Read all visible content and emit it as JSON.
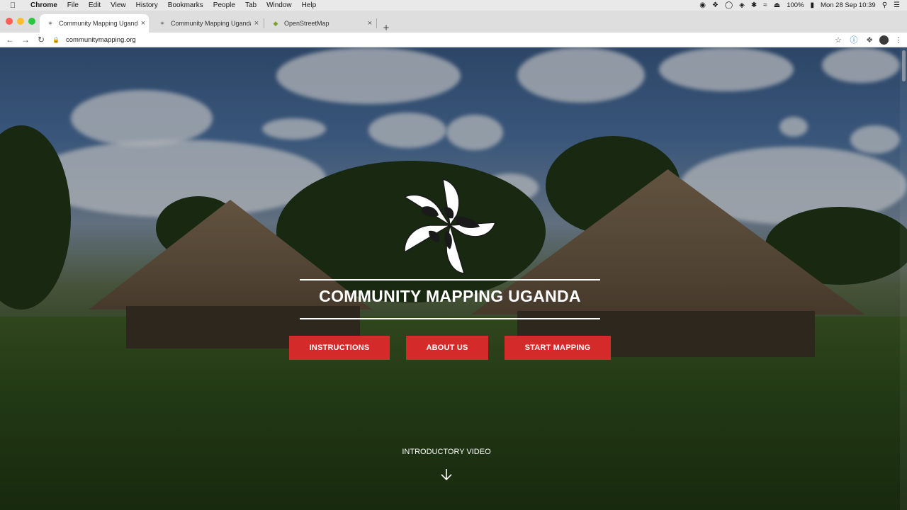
{
  "menubar": {
    "app": "Chrome",
    "items": [
      "File",
      "Edit",
      "View",
      "History",
      "Bookmarks",
      "People",
      "Tab",
      "Window",
      "Help"
    ],
    "battery": "100%",
    "datetime": "Mon 28 Sep  10:39"
  },
  "tabs": [
    {
      "title": "Community Mapping Uganda",
      "icon": "compass-star-favicon",
      "active": true
    },
    {
      "title": "Community Mapping Uganda",
      "icon": "compass-star-favicon",
      "active": false
    },
    {
      "title": "OpenStreetMap",
      "icon": "osm-favicon",
      "active": false
    }
  ],
  "address": {
    "url": "communitymapping.org"
  },
  "hero": {
    "title": "COMMUNITY MAPPING UGANDA",
    "buttons": {
      "instructions": "INSTRUCTIONS",
      "about": "ABOUT US",
      "start": "START MAPPING"
    },
    "intro_video": "INTRODUCTORY VIDEO"
  },
  "colors": {
    "accent": "#d42a2a",
    "text_on_hero": "#ffffff"
  }
}
